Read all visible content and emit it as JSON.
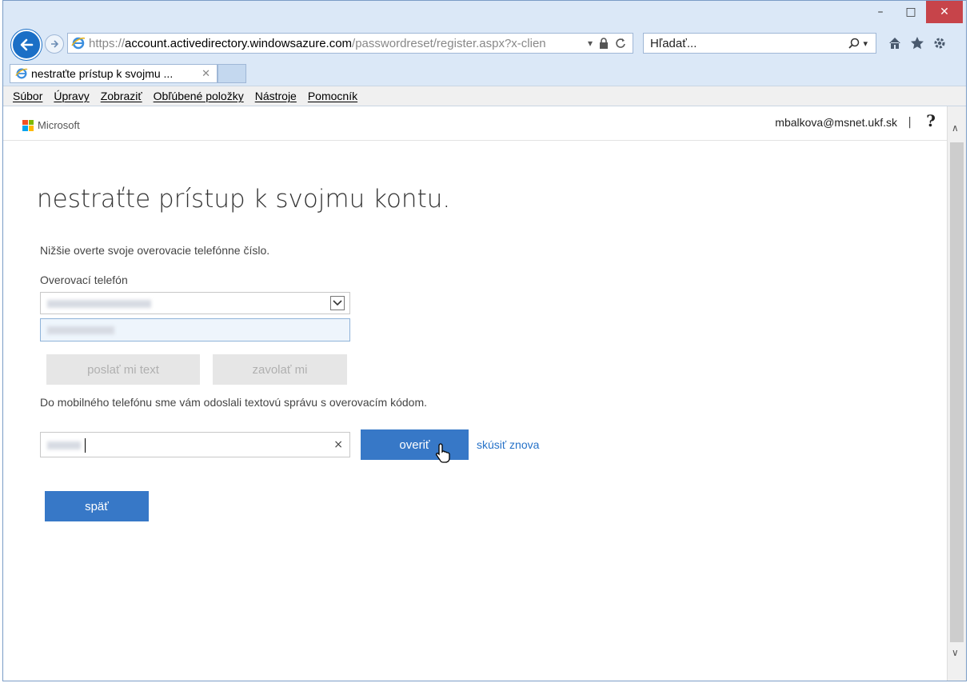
{
  "window": {
    "minimize_glyph": "–",
    "maximize_glyph": "□",
    "close_glyph": "✕"
  },
  "browser": {
    "url_scheme": "https://",
    "url_host": "account.activedirectory.windowsazure.com",
    "url_path": "/passwordreset/register.aspx?x-clien",
    "search_placeholder": "Hľadať...",
    "tab_title": "nestraťte prístup k svojmu ...",
    "tab_close": "✕"
  },
  "menu": {
    "items": [
      "Súbor",
      "Úpravy",
      "Zobraziť",
      "Obľúbené položky",
      "Nástroje",
      "Pomocník"
    ]
  },
  "header": {
    "brand": "Microsoft",
    "user": "mbalkova@msnet.ukf.sk",
    "separator": "|",
    "help": "?"
  },
  "main": {
    "title": "nestraťte prístup k svojmu kontu.",
    "instruction": "Nižšie overte svoje overovacie telefónne číslo.",
    "phone_label": "Overovací telefón",
    "send_text_label": "poslať mi text",
    "call_me_label": "zavolať mi",
    "sent_message": "Do mobilného telefónu sme vám odoslali textovú správu s overovacím kódom.",
    "clear_glyph": "×",
    "verify_label": "overiť",
    "retry_label": "skúsiť znova",
    "back_label": "späť"
  },
  "colors": {
    "accent": "#3778c7",
    "link": "#2672c8",
    "close_red": "#c7444a"
  }
}
